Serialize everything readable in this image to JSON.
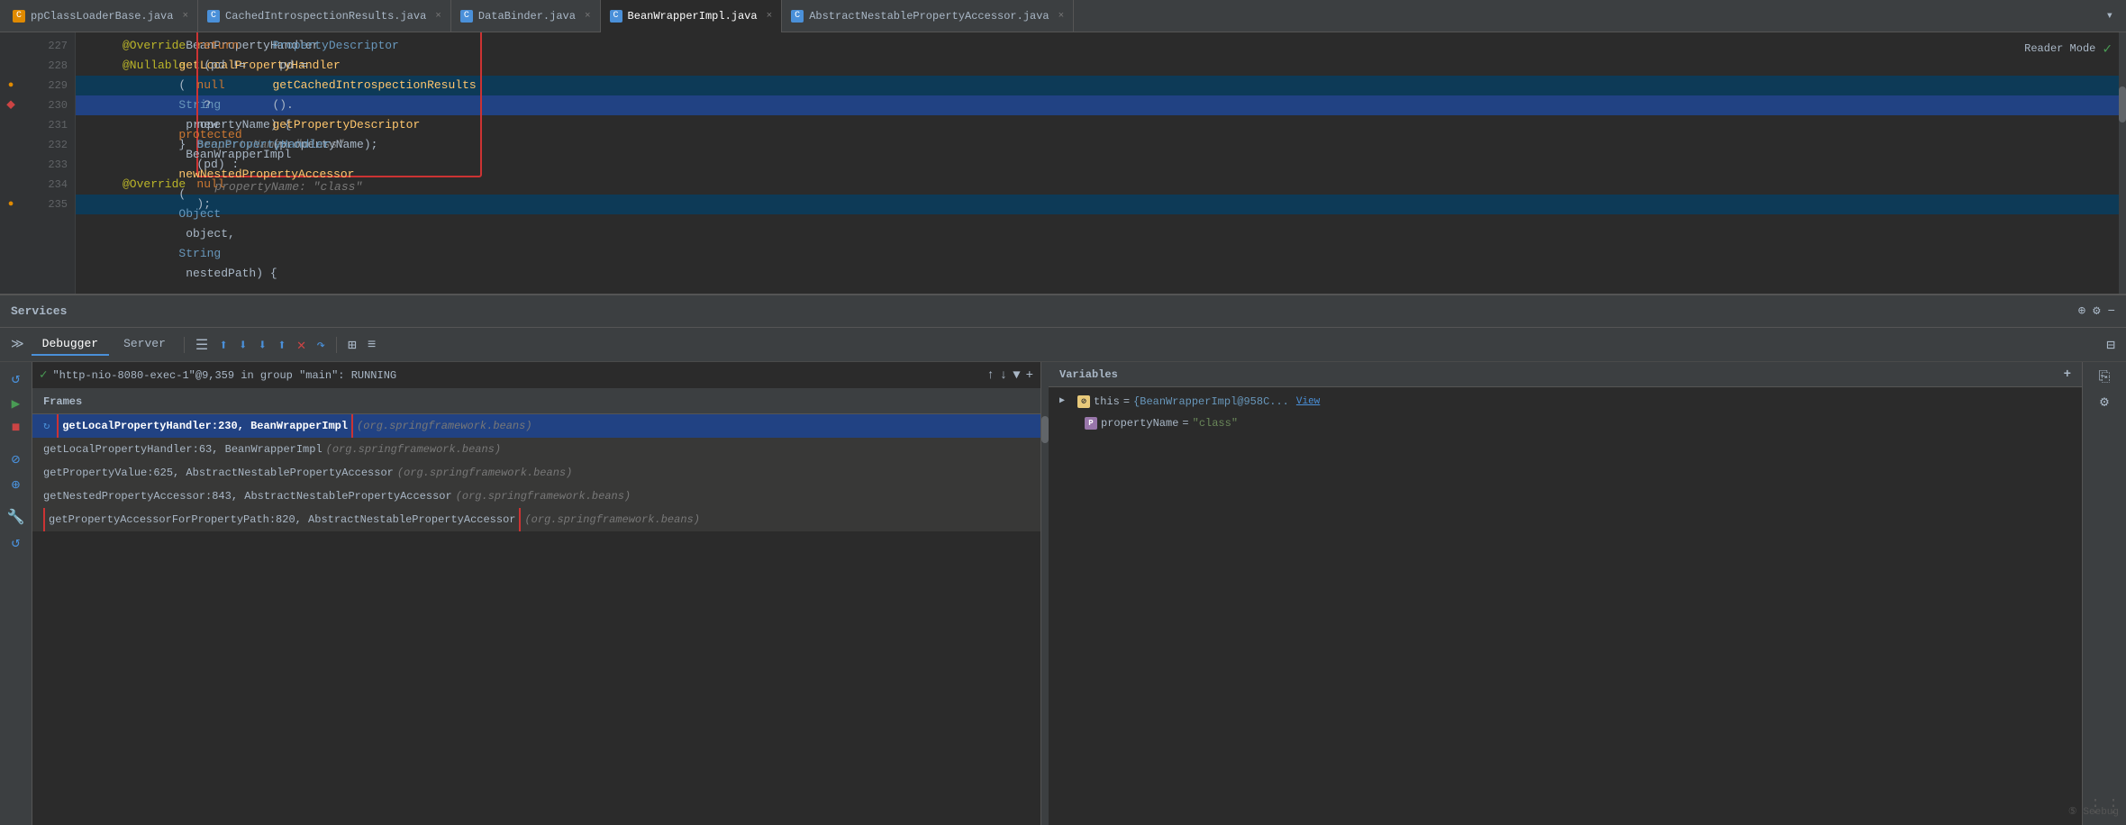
{
  "tabs": [
    {
      "label": "ppClassLoaderBase.java",
      "icon": "orange",
      "active": false
    },
    {
      "label": "CachedIntrospectionResults.java",
      "icon": "blue",
      "active": false
    },
    {
      "label": "DataBinder.java",
      "icon": "blue",
      "active": false
    },
    {
      "label": "BeanWrapperImpl.java",
      "icon": "blue",
      "active": true
    },
    {
      "label": "AbstractNestablePropertyAccessor.java",
      "icon": "blue",
      "active": false
    }
  ],
  "code": {
    "reader_mode_label": "Reader Mode",
    "lines": [
      {
        "num": "227",
        "indent": 2,
        "content": "@Override",
        "type": "annotation",
        "gutter": ""
      },
      {
        "num": "228",
        "indent": 2,
        "content": "@Nullable",
        "type": "annotation",
        "gutter": ""
      },
      {
        "num": "229",
        "indent": 2,
        "content": "protected BeanPropertyHandler getLocalPropertyHandler(String propertyName) {",
        "type": "code",
        "gutter": "bp",
        "hint": "propertyName: \"class\""
      },
      {
        "num": "230",
        "indent": 3,
        "content": "PropertyDescriptor pd = getCachedIntrospectionResults().getPropertyDescriptor(propertyName);",
        "type": "selected",
        "gutter": "error",
        "hint": "propertyName: \"class\""
      },
      {
        "num": "231",
        "indent": 3,
        "content": "return (pd != null ? new BeanPropertyHandler(pd) : null);",
        "type": "code",
        "gutter": ""
      },
      {
        "num": "232",
        "indent": 2,
        "content": "}",
        "type": "code",
        "gutter": ""
      },
      {
        "num": "233",
        "indent": 2,
        "content": "",
        "type": "empty",
        "gutter": ""
      },
      {
        "num": "234",
        "indent": 2,
        "content": "@Override",
        "type": "annotation",
        "gutter": ""
      },
      {
        "num": "235",
        "indent": 2,
        "content": "protected BeanWrapperImpl newNestedPropertyAccessor(Object object, String nestedPath) {",
        "type": "code",
        "gutter": "bp"
      }
    ]
  },
  "services": {
    "title": "Services",
    "toolbar": {
      "debugger_label": "Debugger",
      "server_label": "Server"
    },
    "thread": {
      "label": "\"http-nio-8080-exec-1\"@9,359 in group \"main\": RUNNING"
    },
    "frames": {
      "title": "Frames",
      "items": [
        {
          "name": "getLocalPropertyHandler:230, BeanWrapperImpl",
          "package": "(org.springframework.beans)",
          "selected": true,
          "has_runner": true
        },
        {
          "name": "getLocalPropertyHandler:63, BeanWrapperImpl",
          "package": "(org.springframework.beans)",
          "selected": false
        },
        {
          "name": "getPropertyValue:625, AbstractNestablePropertyAccessor",
          "package": "(org.springframework.beans)",
          "selected": false
        },
        {
          "name": "getNestedPropertyAccessor:843, AbstractNestablePropertyAccessor",
          "package": "(org.springframework.beans)",
          "selected": false
        },
        {
          "name": "getPropertyAccessorForPropertyPath:820, AbstractNestablePropertyAccessor",
          "package": "(org.springframework.beans)",
          "selected": false,
          "red_border": true
        }
      ]
    },
    "variables": {
      "title": "Variables",
      "items": [
        {
          "type": "this",
          "name": "this",
          "value": "{BeanWrapperImpl@958C...",
          "link": "View",
          "expandable": true
        },
        {
          "type": "p",
          "name": "propertyName",
          "value": "\"class\"",
          "expandable": false
        }
      ]
    }
  }
}
